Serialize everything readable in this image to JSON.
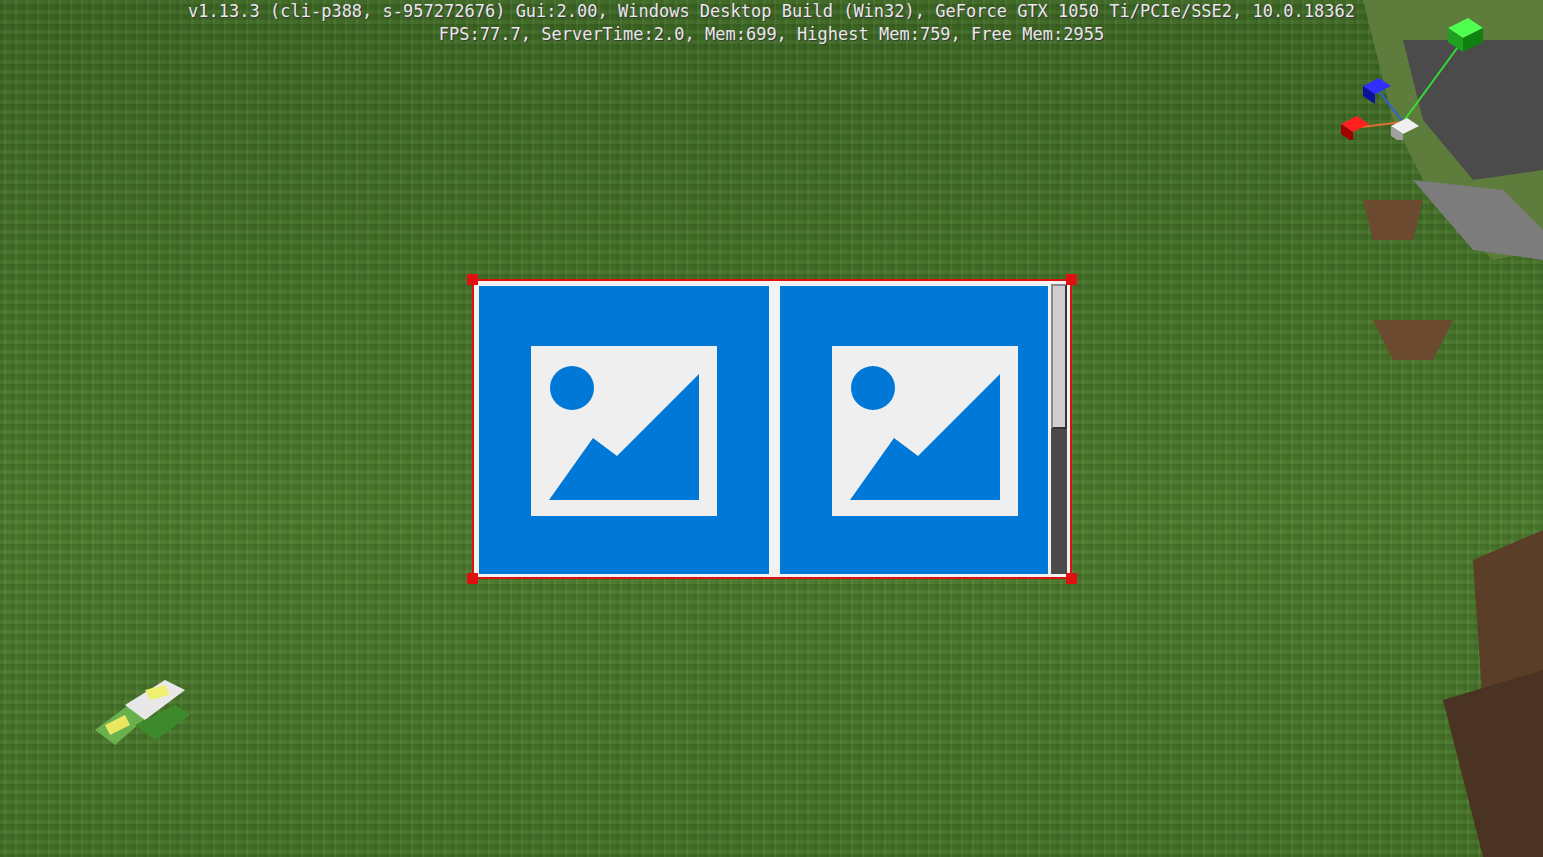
{
  "hud": {
    "debug_lines": [
      "v1.13.3 (cli-p388, s-957272676) Gui:2.00, Windows Desktop Build (Win32), GeForce GTX 1050 Ti/PCIe/SSE2, 10.0.18362",
      "FPS:77.7, ServerTime:2.0, Mem:699, Highest Mem:759, Free Mem:2955"
    ]
  },
  "panel": {
    "selected": true,
    "tiles": [
      {
        "kind": "image"
      },
      {
        "kind": "image"
      }
    ],
    "scrollbar": {
      "level": 0.5
    }
  }
}
